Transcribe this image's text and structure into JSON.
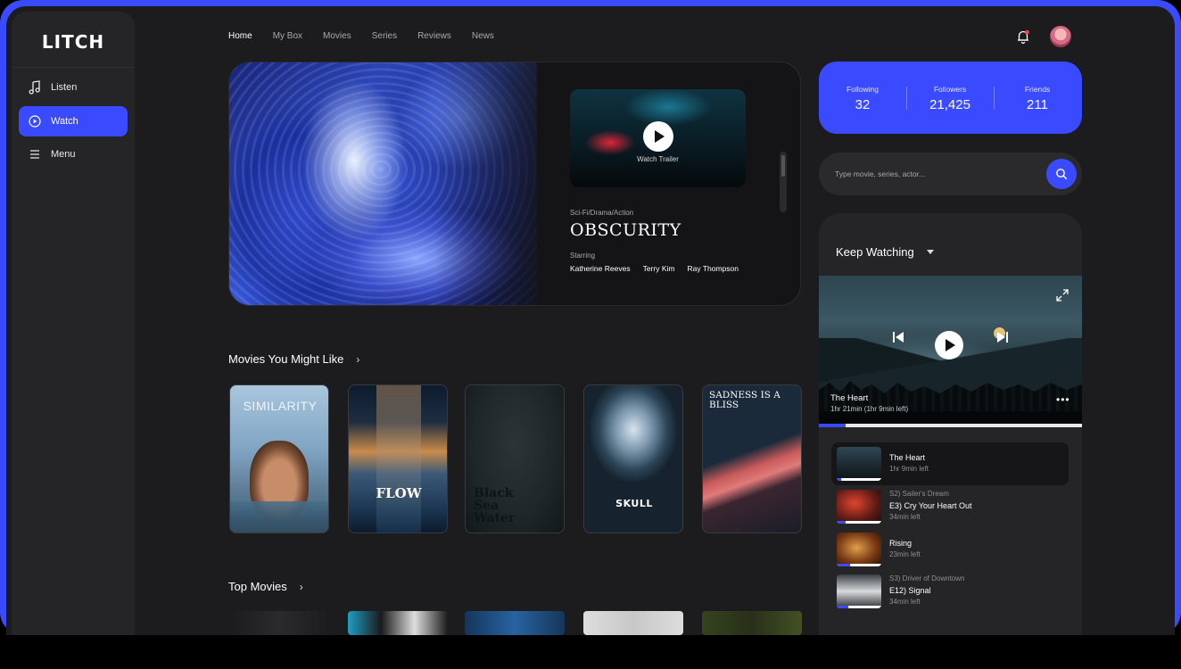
{
  "brand": {
    "logo": "LITCH"
  },
  "sidebar": {
    "items": [
      {
        "label": "Listen",
        "icon": "music-note-icon",
        "active": false
      },
      {
        "label": "Watch",
        "icon": "play-circle-icon",
        "active": true
      },
      {
        "label": "Menu",
        "icon": "menu-icon",
        "active": false
      }
    ]
  },
  "nav": {
    "tabs": [
      {
        "label": "Home",
        "active": true
      },
      {
        "label": "My Box"
      },
      {
        "label": "Movies"
      },
      {
        "label": "Series"
      },
      {
        "label": "Reviews"
      },
      {
        "label": "News"
      }
    ],
    "notification_icon": "bell-icon"
  },
  "hero": {
    "trailer_label": "Watch Trailer",
    "genre": "Sci-Fi/Drama/Action",
    "title": "OBSCURITY",
    "starring_label": "Starring",
    "cast": [
      "Katherine Reeves",
      "Terry Kim",
      "Ray Thompson"
    ]
  },
  "sections": {
    "recommended": "Movies You Might Like",
    "top": "Top Movies"
  },
  "movies": [
    {
      "title": "SIMILARITY"
    },
    {
      "title": "FLOW"
    },
    {
      "title": "Black Sea Water"
    },
    {
      "title": "SKULL"
    },
    {
      "title": "SADNESS IS A BLISS"
    }
  ],
  "stats": {
    "following_label": "Following",
    "following": "32",
    "followers_label": "Followers",
    "followers": "21,425",
    "friends_label": "Friends",
    "friends": "211"
  },
  "search": {
    "placeholder": "Type movie, series, actor..."
  },
  "keep_watching": {
    "title": "Keep Watching",
    "player": {
      "title": "The Heart",
      "time": "1hr 21min (1hr 9min left)",
      "progress": 0.1
    },
    "episodes": [
      {
        "subtitle": "",
        "name": "The Heart",
        "left": "1hr 9min left",
        "progress": 0.1,
        "active": true
      },
      {
        "subtitle": "S2) Sailer's Dream",
        "name": "E3) Cry Your Heart Out",
        "left": "34min left",
        "progress": 0.2
      },
      {
        "subtitle": "",
        "name": "Rising",
        "left": "23min left",
        "progress": 0.3
      },
      {
        "subtitle": "S3) Driver of Downtown",
        "name": "E12) Signal",
        "left": "34min left",
        "progress": 0.25
      }
    ]
  },
  "colors": {
    "accent": "#3a4bff",
    "background": "#1c1c1e",
    "panel": "#252527"
  }
}
